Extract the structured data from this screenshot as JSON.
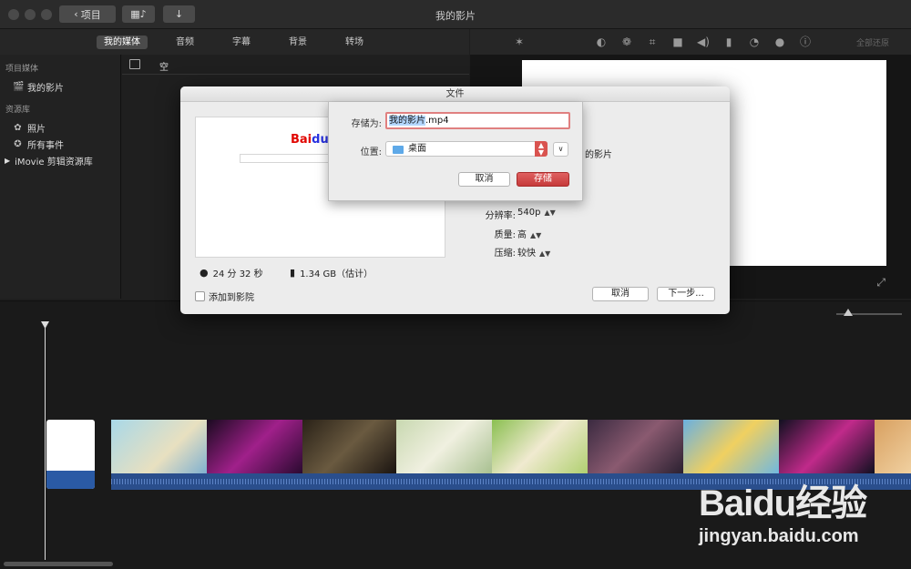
{
  "window": {
    "title": "我的影片",
    "back_label": "项目"
  },
  "tabs": [
    {
      "label": "我的媒体",
      "active": true
    },
    {
      "label": "音频",
      "active": false
    },
    {
      "label": "字幕",
      "active": false
    },
    {
      "label": "背景",
      "active": false
    },
    {
      "label": "转场",
      "active": false
    }
  ],
  "viewer_toolbar": {
    "icons": [
      "magic-wand-icon",
      "color-balance-icon",
      "color-palette-icon",
      "crop-icon",
      "camera-stabilize-icon",
      "volume-icon",
      "equalizer-icon",
      "speed-icon",
      "filter-icon",
      "info-icon"
    ],
    "reset_all": "全部还原"
  },
  "sidebar": {
    "section_project": "项目媒体",
    "project_item": "我的影片",
    "section_library": "资源库",
    "library_items": [
      "照片",
      "所有事件",
      "iMovie 剪辑资源库"
    ]
  },
  "browser": {
    "empty_label": "空"
  },
  "dialog": {
    "title": "文件",
    "duration": "24 分 32 秒",
    "file_size": "1.34 GB（估计）",
    "settings": [
      {
        "label": "分辨率:",
        "value": "540p"
      },
      {
        "label": "质量:",
        "value": "高"
      },
      {
        "label": "压缩:",
        "value": "较快"
      }
    ],
    "partial_text": "的影片",
    "add_to_theater": "添加到影院",
    "cancel": "取消",
    "next": "下一步..."
  },
  "save_sheet": {
    "save_as_label": "存储为:",
    "filename_selected": "我的影片",
    "filename_ext": ".mp4",
    "location_label": "位置:",
    "location_value": "桌面",
    "cancel": "取消",
    "save": "存储"
  },
  "preview_logo": {
    "bai": "Bai",
    "du": "du"
  },
  "watermark": {
    "logo": "Baidu经验",
    "url": "jingyan.baidu.com"
  },
  "colors": {
    "accent_red": "#d9534f",
    "baidu_blue": "#2932e1",
    "baidu_red": "#e10601"
  }
}
